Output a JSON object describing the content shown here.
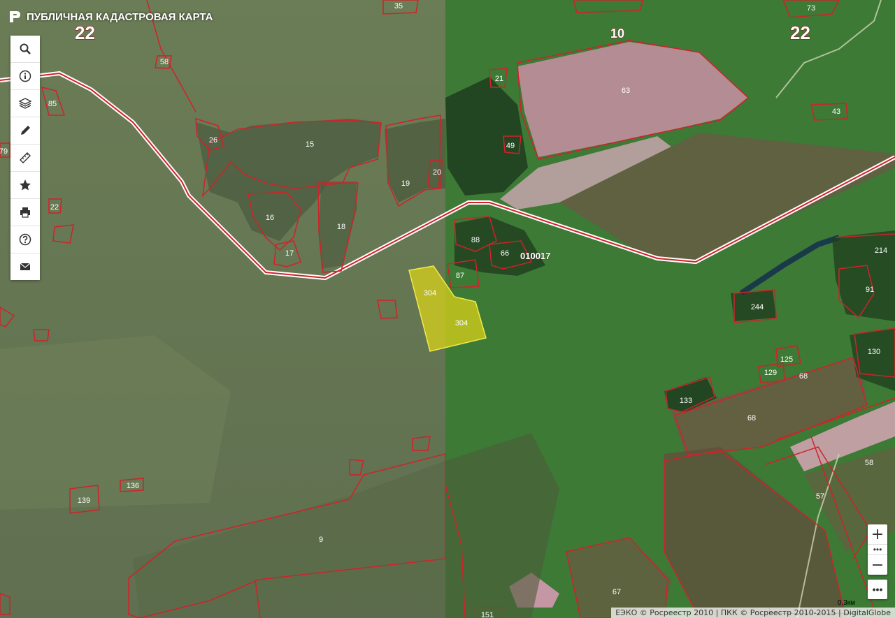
{
  "app": {
    "title": "ПУБЛИЧНАЯ КАДАСТРОВАЯ КАРТА"
  },
  "toolbar": {
    "items": [
      {
        "name": "search",
        "icon": "search-icon"
      },
      {
        "name": "info",
        "icon": "info-icon"
      },
      {
        "name": "layers",
        "icon": "layers-icon"
      },
      {
        "name": "draw",
        "icon": "pencil-icon"
      },
      {
        "name": "measure",
        "icon": "ruler-pencil-icon"
      },
      {
        "name": "favorites",
        "icon": "star-icon"
      },
      {
        "name": "print",
        "icon": "printer-icon"
      },
      {
        "name": "help",
        "icon": "help-icon"
      },
      {
        "name": "feedback",
        "icon": "mail-icon"
      }
    ]
  },
  "map": {
    "district_labels": [
      "22",
      "22",
      "10"
    ],
    "block_label": "010017",
    "parcel_labels": [
      "35",
      "58",
      "63",
      "73",
      "43",
      "85",
      "79",
      "26",
      "15",
      "19",
      "20",
      "21",
      "49",
      "22",
      "16",
      "18",
      "17",
      "88",
      "66",
      "87",
      "304",
      "304",
      "214",
      "91",
      "244",
      "130",
      "125",
      "129",
      "68",
      "133",
      "68",
      "58",
      "57",
      "136",
      "139",
      "9",
      "67",
      "151"
    ],
    "selected_parcel": "304",
    "colors": {
      "parcel_outline": "#d0222a",
      "selected_fill": "#d8d21a",
      "boundary": "#ffffff"
    }
  },
  "zoom": {
    "in": "+",
    "mid": "•••",
    "out": "−"
  },
  "more": {
    "label": "•••"
  },
  "scale": {
    "label": "0,3км"
  },
  "attribution": {
    "text": "ЕЭКО © Росреестр 2010 | ПКК © Росреестр 2010-2015 | DigitalGlobe"
  }
}
